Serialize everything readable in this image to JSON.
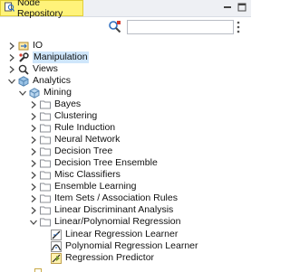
{
  "panel": {
    "title": "Node Repository"
  },
  "search": {
    "value": "",
    "placeholder": ""
  },
  "colors": {
    "tab_bg": "#fff37a",
    "selection": "#cfe6fb",
    "folder": "#8b8f96",
    "accent": "#2f6fc0"
  },
  "tree": [
    {
      "label": "IO",
      "expanded": false,
      "icon": "io-icon",
      "selected": false
    },
    {
      "label": "Manipulation",
      "expanded": false,
      "icon": "wrench-icon",
      "selected": true
    },
    {
      "label": "Views",
      "expanded": false,
      "icon": "views-icon",
      "selected": false
    },
    {
      "label": "Analytics",
      "expanded": true,
      "icon": "analytics-icon",
      "selected": false
    },
    {
      "label": "Mining",
      "expanded": true,
      "icon": "mining-icon",
      "selected": false
    },
    {
      "label": "Bayes",
      "expanded": false,
      "icon": "folder-icon"
    },
    {
      "label": "Clustering",
      "expanded": false,
      "icon": "folder-icon"
    },
    {
      "label": "Rule Induction",
      "expanded": false,
      "icon": "folder-icon"
    },
    {
      "label": "Neural Network",
      "expanded": false,
      "icon": "folder-icon"
    },
    {
      "label": "Decision Tree",
      "expanded": false,
      "icon": "folder-icon"
    },
    {
      "label": "Decision Tree Ensemble",
      "expanded": false,
      "icon": "folder-icon"
    },
    {
      "label": "Misc Classifiers",
      "expanded": false,
      "icon": "folder-icon"
    },
    {
      "label": "Ensemble Learning",
      "expanded": false,
      "icon": "folder-icon"
    },
    {
      "label": "Item Sets / Association Rules",
      "expanded": false,
      "icon": "folder-icon"
    },
    {
      "label": "Linear Discriminant Analysis",
      "expanded": false,
      "icon": "folder-icon"
    },
    {
      "label": "Linear/Polynomial Regression",
      "expanded": true,
      "icon": "folder-icon"
    },
    {
      "label": "Linear Regression Learner",
      "icon": "linear-learner-icon"
    },
    {
      "label": "Polynomial Regression Learner",
      "icon": "polynomial-learner-icon"
    },
    {
      "label": "Regression Predictor",
      "icon": "predictor-icon"
    }
  ]
}
